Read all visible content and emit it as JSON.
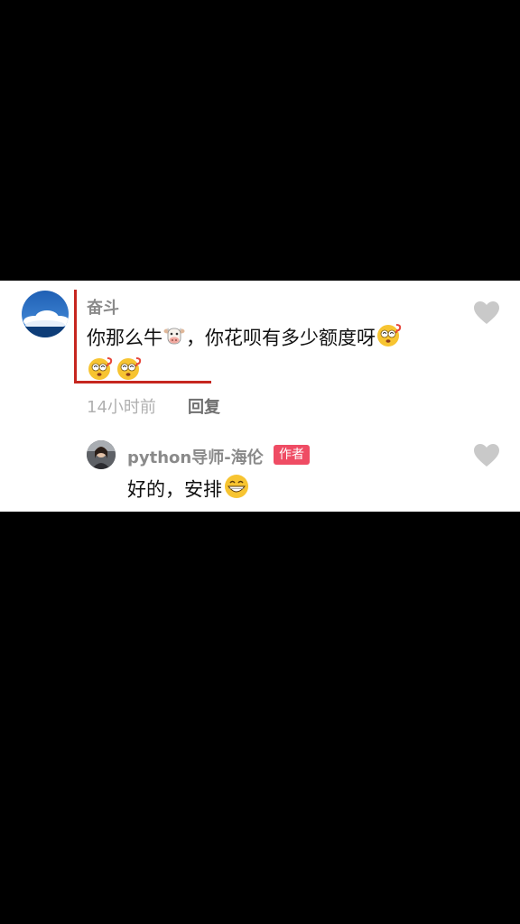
{
  "comment": {
    "username": "奋斗",
    "text_part1": "你那么牛",
    "text_part2": "，你花呗有多少额度呀",
    "time": "14小时前",
    "reply_label": "回复",
    "emojis": [
      "cow-face-emoji",
      "dizzy-face-emoji",
      "dizzy-face-emoji",
      "dizzy-face-emoji"
    ],
    "highlight_color": "#c6261f"
  },
  "reply": {
    "username": "python导师-海伦",
    "badge": "作者",
    "badge_color": "#ef4c64",
    "text": "好的，安排",
    "emoji": "grinning-face-emoji"
  },
  "icons": [
    "heart-icon",
    "heart-icon"
  ]
}
